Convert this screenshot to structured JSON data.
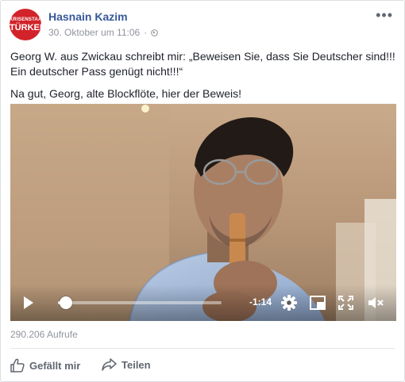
{
  "post": {
    "author": "Hasnain Kazim",
    "date": "30. Oktober um 11:06",
    "separator": "·",
    "privacy_icon": "globe-icon",
    "avatar_text": [
      "KRISENSTAAT",
      "TÜRKEI"
    ],
    "avatar_color": "#d2232a",
    "more_label": "•••",
    "paragraph1": "Georg W. aus Zwickau schreibt mir: „Beweisen Sie, dass Sie Deutscher sind!!! Ein deutscher Pass genügt nicht!!!“",
    "paragraph2": "Na gut, Georg, alte Blockflöte, hier der Beweis!"
  },
  "video": {
    "progress_fraction": 0.05,
    "time_remaining": "-1:14",
    "controls": [
      "play-icon",
      "gear-icon",
      "picture-in-picture-icon",
      "fullscreen-icon",
      "mute-icon"
    ]
  },
  "stats": {
    "views": "290.206 Aufrufe"
  },
  "actions": {
    "like": "Gefällt mir",
    "share": "Teilen"
  },
  "colors": {
    "link": "#365899",
    "meta": "#90949c",
    "action": "#606770"
  }
}
